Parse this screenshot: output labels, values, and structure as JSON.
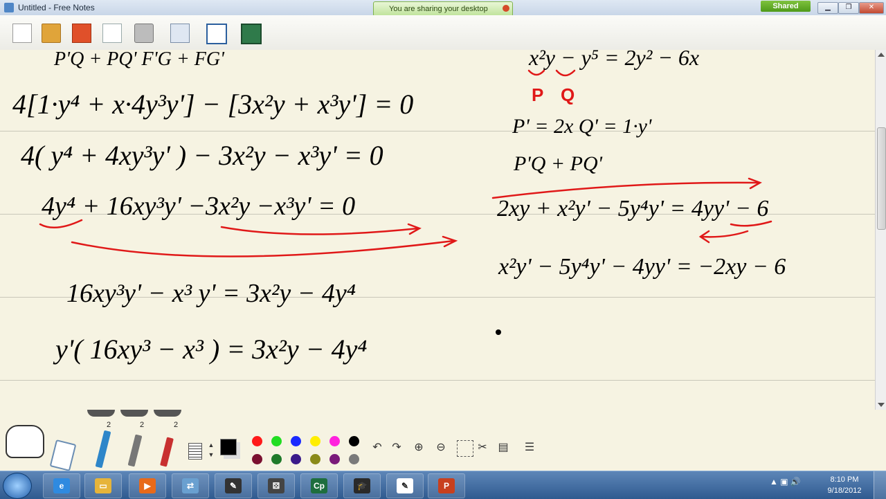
{
  "window": {
    "title": "Untitled - Free Notes",
    "share_banner": "You are sharing your desktop",
    "shared_badge": "Shared"
  },
  "toolbar": {
    "icons": [
      "new-note-icon",
      "open-folder-icon",
      "save-icon",
      "print-preview-icon",
      "print-icon",
      "export-icon",
      "window-icon",
      "whiteboard-icon"
    ]
  },
  "notes": {
    "handwriting_left": [
      "P'Q + PQ'        F'G + FG'",
      "4[1·y⁴ + x·4y³y'] − [3x²y + x³y'] = 0",
      "4( y⁴ + 4xy³y' ) − 3x²y − x³y' = 0",
      "4y⁴ + 16xy³y' −3x²y −x³y' = 0",
      "16xy³y' − x³ y' = 3x²y − 4y⁴",
      "y'( 16xy³ − x³ ) = 3x²y − 4y⁴"
    ],
    "handwriting_right": [
      "x²y − y⁵ = 2y² − 6x",
      "P    Q",
      "P' = 2x   Q' = 1·y'",
      "P'Q + PQ'",
      "2xy + x²y' − 5y⁴y' = 4yy' − 6",
      "x²y' − 5y⁴y' − 4yy' = −2xy − 6"
    ],
    "annotation_letters": {
      "p": "P",
      "q": "Q"
    }
  },
  "palette": {
    "pen_sizes": [
      "2",
      "2",
      "2"
    ],
    "line_width_up": "▲",
    "line_width_down": "▼",
    "colors_top": [
      "#ff1a1a",
      "#22dd22",
      "#1a2aff",
      "#ffee00",
      "#ff22dd",
      "#000000"
    ],
    "colors_bottom": [
      "#7a1030",
      "#1f7a2a",
      "#3a1a8a",
      "#8a8a18",
      "#7a1a7a",
      "#7a7a7a"
    ],
    "undo": "↶",
    "redo": "↷",
    "zoom_in": "⊕",
    "zoom_out": "⊖"
  },
  "taskbar": {
    "apps": [
      {
        "name": "ie",
        "glyph": "e",
        "color": "#2f8ae0"
      },
      {
        "name": "explorer",
        "glyph": "▭",
        "color": "#e6b43a"
      },
      {
        "name": "media",
        "glyph": "▶",
        "color": "#e86a1a"
      },
      {
        "name": "network",
        "glyph": "⇄",
        "color": "#6aa0d0"
      },
      {
        "name": "notes",
        "glyph": "✎",
        "color": "#333333"
      },
      {
        "name": "dice",
        "glyph": "⚄",
        "color": "#444444"
      },
      {
        "name": "captivate",
        "glyph": "Cp",
        "color": "#1e6e3e"
      },
      {
        "name": "graduation",
        "glyph": "🎓",
        "color": "#2a2a2a"
      },
      {
        "name": "freenotes",
        "glyph": "✎",
        "color": "#ffffff"
      },
      {
        "name": "powerpoint",
        "glyph": "P",
        "color": "#c8401e"
      }
    ],
    "time": "8:10 PM",
    "date": "9/18/2012"
  }
}
